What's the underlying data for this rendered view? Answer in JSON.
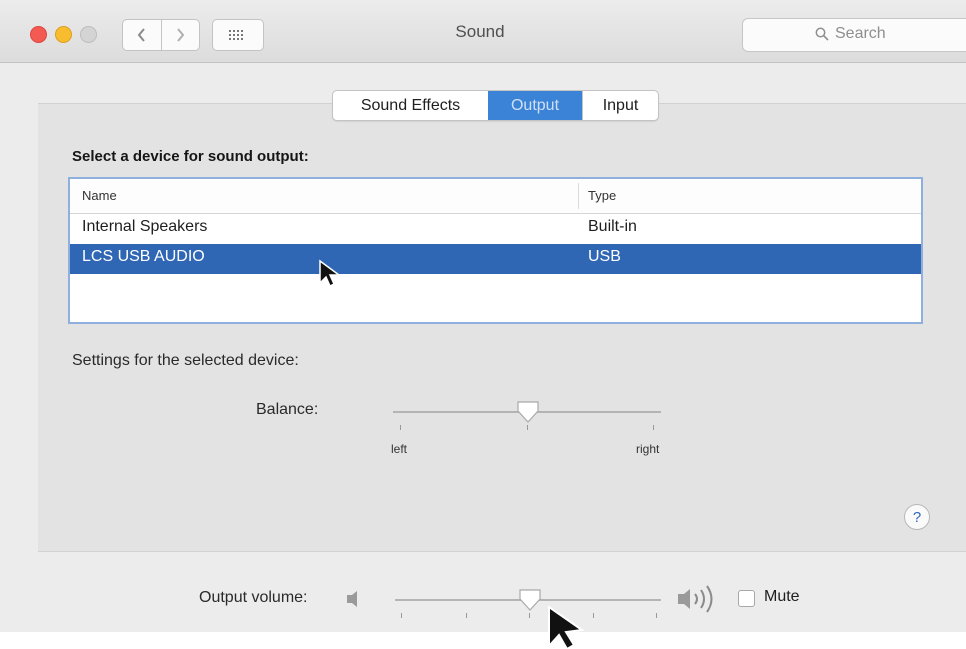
{
  "window": {
    "title": "Sound",
    "search_placeholder": "Search",
    "traffic_lights": {
      "close": "#f25a52",
      "minimize": "#f8bd2e",
      "zoom": "#d4d4d4"
    },
    "icons": [
      "back-icon",
      "forward-icon",
      "grid-icon",
      "search-icon"
    ]
  },
  "tabs": {
    "items": [
      {
        "label": "Sound Effects",
        "selected": false
      },
      {
        "label": "Output",
        "selected": true
      },
      {
        "label": "Input",
        "selected": false
      }
    ],
    "accent": "#3b83d6"
  },
  "device_select": {
    "heading": "Select a device for sound output:",
    "columns": [
      "Name",
      "Type"
    ],
    "rows": [
      {
        "name": "Internal Speakers",
        "type": "Built-in",
        "selected": false
      },
      {
        "name": "LCS USB AUDIO",
        "type": "USB",
        "selected": true
      }
    ],
    "selection_color": "#2f67b5"
  },
  "settings": {
    "heading": "Settings for the selected device:",
    "balance": {
      "label": "Balance:",
      "left_label": "left",
      "right_label": "right",
      "value": 0.5
    }
  },
  "help": {
    "label": "?"
  },
  "volume": {
    "label": "Output volume:",
    "value": 0.5,
    "mute_label": "Mute",
    "muted": false,
    "icons": [
      "speaker-low-icon",
      "speaker-high-icon"
    ]
  }
}
